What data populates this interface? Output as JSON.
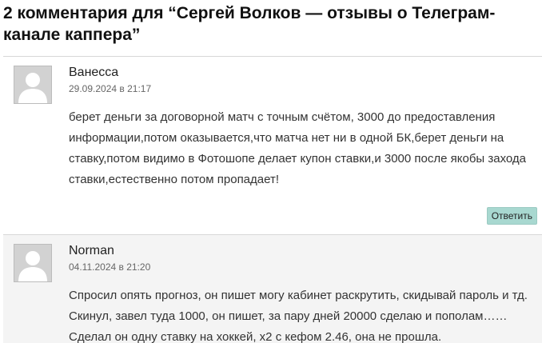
{
  "heading": "2 комментария для “Сергей Волков — отзывы о Телеграм-канале каппера”",
  "comments": [
    {
      "author": "Ванесса",
      "date": "29.09.2024 в 21:17",
      "text": "берет деньги за договорной матч с точным счётом, 3000 до предоставления информации,потом оказывается,что матча нет ни в одной БК,берет деньги на ставку,потом видимо в Фотошопе делает купон ставки,и 3000 после якобы захода ставки,естественно потом пропадает!",
      "reply_label": "Ответить"
    },
    {
      "author": "Norman",
      "date": "04.11.2024 в 21:20",
      "text": "Спросил опять прогноз, он пишет могу кабинет раскрутить, скидывай пароль и тд. Скинул, завел туда 1000, он пишет, за пару дней 20000 сделаю и пополам…… Сделал он одну ставку на хоккей, х2 с кефом 2.46, она не прошла."
    }
  ],
  "colors": {
    "reply_button_bg": "#a8d8d0",
    "second_comment_bg": "#f4f4f4",
    "divider": "#d7d7d7",
    "avatar_bg": "#d2d2d2"
  },
  "icons": {
    "avatar": "default-user-avatar-icon"
  }
}
